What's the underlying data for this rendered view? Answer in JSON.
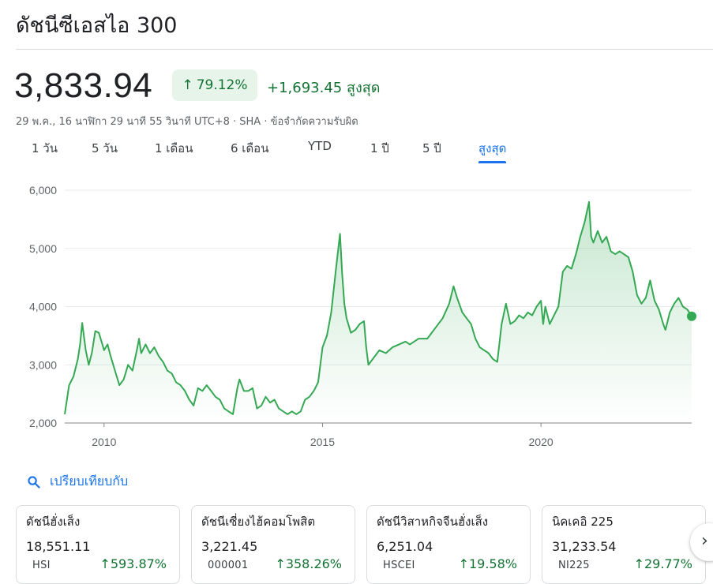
{
  "header": {
    "title": "ดัชนีซีเอสไอ 300"
  },
  "quote": {
    "price": "3,833.94",
    "change_pct": "79.12%",
    "change_abs": "+1,693.45 สูงสุด",
    "meta": "29 พ.ค., 16 นาฬิกา 29 นาที 55 วินาที UTC+8 · SHA · ข้อจำกัดความรับผิด",
    "up_color": "#137333",
    "up_bg": "#e6f4ea"
  },
  "ranges": [
    {
      "label": "1 วัน",
      "active": false
    },
    {
      "label": "5 วัน",
      "active": false
    },
    {
      "label": "1 เดือน",
      "active": false
    },
    {
      "label": "6 เดือน",
      "active": false
    },
    {
      "label": "YTD",
      "active": false
    },
    {
      "label": "1 ปี",
      "active": false
    },
    {
      "label": "5 ปี",
      "active": false
    },
    {
      "label": "สูงสุด",
      "active": true
    }
  ],
  "chart_data": {
    "type": "area",
    "line_color": "#34a853",
    "y_ticks": [
      "6,000",
      "5,000",
      "4,000",
      "3,000",
      "2,000"
    ],
    "ylim": [
      2000,
      6000
    ],
    "x_ticks": [
      "2010",
      "2015",
      "2020"
    ],
    "xlim": [
      2009.1,
      2023.45
    ],
    "grid": true,
    "series": [
      {
        "points": [
          [
            2009.1,
            2150
          ],
          [
            2009.2,
            2650
          ],
          [
            2009.3,
            2800
          ],
          [
            2009.4,
            3100
          ],
          [
            2009.45,
            3350
          ],
          [
            2009.5,
            3720
          ],
          [
            2009.58,
            3250
          ],
          [
            2009.65,
            3000
          ],
          [
            2009.72,
            3200
          ],
          [
            2009.8,
            3580
          ],
          [
            2009.88,
            3550
          ],
          [
            2009.95,
            3380
          ],
          [
            2010.0,
            3250
          ],
          [
            2010.08,
            3350
          ],
          [
            2010.15,
            3150
          ],
          [
            2010.25,
            2900
          ],
          [
            2010.35,
            2650
          ],
          [
            2010.45,
            2750
          ],
          [
            2010.55,
            3000
          ],
          [
            2010.65,
            2900
          ],
          [
            2010.75,
            3250
          ],
          [
            2010.8,
            3450
          ],
          [
            2010.85,
            3200
          ],
          [
            2010.95,
            3350
          ],
          [
            2011.05,
            3200
          ],
          [
            2011.15,
            3300
          ],
          [
            2011.25,
            3150
          ],
          [
            2011.35,
            3050
          ],
          [
            2011.45,
            2900
          ],
          [
            2011.55,
            2850
          ],
          [
            2011.65,
            2700
          ],
          [
            2011.75,
            2650
          ],
          [
            2011.85,
            2550
          ],
          [
            2011.95,
            2400
          ],
          [
            2012.05,
            2300
          ],
          [
            2012.15,
            2600
          ],
          [
            2012.25,
            2550
          ],
          [
            2012.35,
            2650
          ],
          [
            2012.45,
            2550
          ],
          [
            2012.55,
            2450
          ],
          [
            2012.65,
            2400
          ],
          [
            2012.75,
            2250
          ],
          [
            2012.85,
            2200
          ],
          [
            2012.95,
            2150
          ],
          [
            2013.05,
            2600
          ],
          [
            2013.1,
            2750
          ],
          [
            2013.2,
            2550
          ],
          [
            2013.3,
            2550
          ],
          [
            2013.4,
            2600
          ],
          [
            2013.5,
            2250
          ],
          [
            2013.6,
            2300
          ],
          [
            2013.7,
            2450
          ],
          [
            2013.8,
            2350
          ],
          [
            2013.9,
            2400
          ],
          [
            2014.0,
            2250
          ],
          [
            2014.1,
            2200
          ],
          [
            2014.2,
            2150
          ],
          [
            2014.3,
            2200
          ],
          [
            2014.4,
            2150
          ],
          [
            2014.5,
            2200
          ],
          [
            2014.6,
            2400
          ],
          [
            2014.7,
            2450
          ],
          [
            2014.8,
            2550
          ],
          [
            2014.9,
            2700
          ],
          [
            2015.0,
            3300
          ],
          [
            2015.1,
            3500
          ],
          [
            2015.2,
            3900
          ],
          [
            2015.3,
            4600
          ],
          [
            2015.4,
            5250
          ],
          [
            2015.45,
            4550
          ],
          [
            2015.5,
            4050
          ],
          [
            2015.55,
            3800
          ],
          [
            2015.65,
            3550
          ],
          [
            2015.75,
            3600
          ],
          [
            2015.85,
            3700
          ],
          [
            2015.95,
            3750
          ],
          [
            2016.0,
            3300
          ],
          [
            2016.05,
            3000
          ],
          [
            2016.15,
            3100
          ],
          [
            2016.3,
            3250
          ],
          [
            2016.45,
            3200
          ],
          [
            2016.6,
            3300
          ],
          [
            2016.75,
            3350
          ],
          [
            2016.9,
            3400
          ],
          [
            2017.0,
            3350
          ],
          [
            2017.2,
            3450
          ],
          [
            2017.4,
            3450
          ],
          [
            2017.6,
            3650
          ],
          [
            2017.75,
            3800
          ],
          [
            2017.9,
            4050
          ],
          [
            2018.0,
            4350
          ],
          [
            2018.08,
            4150
          ],
          [
            2018.2,
            3900
          ],
          [
            2018.3,
            3800
          ],
          [
            2018.4,
            3700
          ],
          [
            2018.5,
            3450
          ],
          [
            2018.6,
            3300
          ],
          [
            2018.7,
            3250
          ],
          [
            2018.8,
            3200
          ],
          [
            2018.9,
            3100
          ],
          [
            2019.0,
            3050
          ],
          [
            2019.1,
            3700
          ],
          [
            2019.2,
            4050
          ],
          [
            2019.3,
            3700
          ],
          [
            2019.4,
            3750
          ],
          [
            2019.5,
            3850
          ],
          [
            2019.6,
            3800
          ],
          [
            2019.7,
            3900
          ],
          [
            2019.8,
            3850
          ],
          [
            2019.9,
            4000
          ],
          [
            2020.0,
            4100
          ],
          [
            2020.05,
            3700
          ],
          [
            2020.1,
            4000
          ],
          [
            2020.2,
            3700
          ],
          [
            2020.3,
            3850
          ],
          [
            2020.4,
            4000
          ],
          [
            2020.5,
            4600
          ],
          [
            2020.6,
            4700
          ],
          [
            2020.7,
            4650
          ],
          [
            2020.8,
            4900
          ],
          [
            2020.9,
            5200
          ],
          [
            2021.0,
            5450
          ],
          [
            2021.1,
            5800
          ],
          [
            2021.15,
            5200
          ],
          [
            2021.2,
            5100
          ],
          [
            2021.3,
            5300
          ],
          [
            2021.4,
            5100
          ],
          [
            2021.5,
            5200
          ],
          [
            2021.6,
            4950
          ],
          [
            2021.7,
            4900
          ],
          [
            2021.8,
            4950
          ],
          [
            2021.9,
            4900
          ],
          [
            2022.0,
            4850
          ],
          [
            2022.1,
            4600
          ],
          [
            2022.2,
            4200
          ],
          [
            2022.3,
            4050
          ],
          [
            2022.4,
            4150
          ],
          [
            2022.5,
            4450
          ],
          [
            2022.6,
            4100
          ],
          [
            2022.7,
            3950
          ],
          [
            2022.8,
            3700
          ],
          [
            2022.85,
            3600
          ],
          [
            2022.95,
            3900
          ],
          [
            2023.05,
            4050
          ],
          [
            2023.15,
            4150
          ],
          [
            2023.25,
            4000
          ],
          [
            2023.35,
            3950
          ],
          [
            2023.45,
            3834
          ]
        ]
      }
    ]
  },
  "compare": {
    "label": "เปรียบเทียบกับ"
  },
  "cards": [
    {
      "name": "ดัชนีฮั่งเส็ง",
      "value": "18,551.11",
      "ticker": "HSI",
      "pct": "593.87%"
    },
    {
      "name": "ดัชนีเซี่ยงไฮ้คอมโพสิต",
      "value": "3,221.45",
      "ticker": "000001",
      "pct": "358.26%"
    },
    {
      "name": "ดัชนีวิสาหกิจจีนฮั่งเส็ง",
      "value": "6,251.04",
      "ticker": "HSCEI",
      "pct": "19.58%"
    },
    {
      "name": "นิคเคอิ 225",
      "value": "31,233.54",
      "ticker": "NI225",
      "pct": "29.77%"
    }
  ]
}
